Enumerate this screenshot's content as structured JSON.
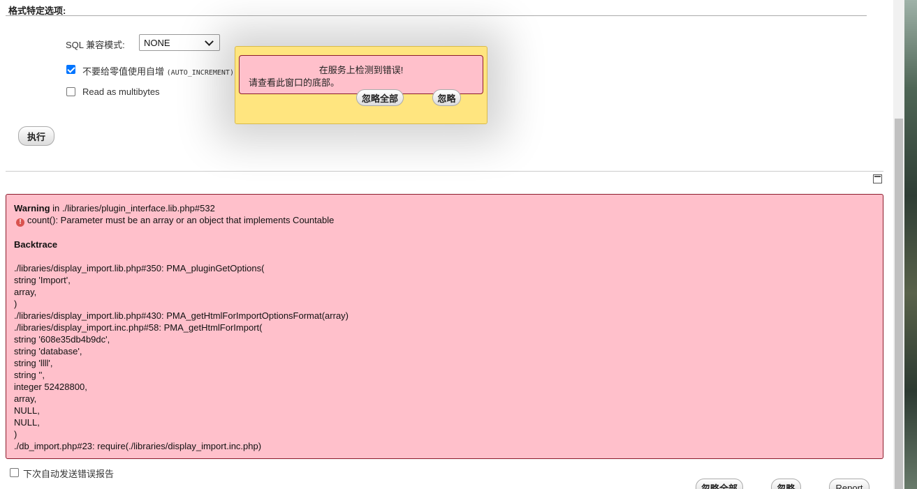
{
  "format_options": {
    "title": "格式特定选项:",
    "sql_compat_label": "SQL 兼容模式:",
    "sql_compat_value": "NONE",
    "no_auto_value_label": "不要给零值使用自增",
    "no_auto_value_code": "(AUTO_INCREMENT)",
    "no_auto_value_checked": true,
    "read_multibytes_label": "Read as multibytes",
    "read_multibytes_checked": false
  },
  "execute_button": "执行",
  "popup": {
    "line1": "在服务上检测到错误!",
    "line2": "请查看此窗口的底部。",
    "ignore_all": "忽略全部",
    "ignore": "忽略"
  },
  "error": {
    "warning_label": "Warning",
    "warning_location": " in ./libraries/plugin_interface.lib.php#532",
    "message": "count(): Parameter must be an array or an object that implements Countable",
    "backtrace_label": "Backtrace",
    "backtrace": [
      "./libraries/display_import.lib.php#350: PMA_pluginGetOptions(",
      "string 'Import',",
      "array,",
      ")",
      "./libraries/display_import.lib.php#430: PMA_getHtmlForImportOptionsFormat(array)",
      "./libraries/display_import.inc.php#58: PMA_getHtmlForImport(",
      "string '608e35db4b9dc',",
      "string 'database',",
      "string 'llll',",
      "string '',",
      "integer 52428800,",
      "array,",
      "NULL,",
      "NULL,",
      ")",
      "./db_import.php#23: require(./libraries/display_import.inc.php)"
    ]
  },
  "footer": {
    "auto_send_label": "下次自动发送错误报告",
    "auto_send_checked": false,
    "ignore_all": "忽略全部",
    "ignore": "忽略",
    "report": "Report"
  },
  "colors": {
    "popup_bg": "#ffe57f",
    "error_bg": "#ffc0cb",
    "error_border": "#8b1a2b",
    "checkbox_checked": "#0075ff"
  },
  "icons": {
    "error": "error-circle-icon",
    "toggle": "window-toggle-icon",
    "dropdown": "chevron-down-icon"
  }
}
